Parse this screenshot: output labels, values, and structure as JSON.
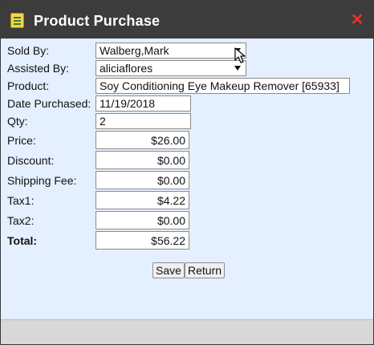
{
  "window": {
    "title": "Product Purchase",
    "icon": "notepad-icon",
    "close_icon": "close-icon"
  },
  "form": {
    "sold_by": {
      "label": "Sold By:",
      "value": "Walberg,Mark"
    },
    "assisted_by": {
      "label": "Assisted By:",
      "value": "aliciaflores"
    },
    "product": {
      "label": "Product:",
      "value": "Soy Conditioning Eye Makeup Remover [65933]"
    },
    "date_purchased": {
      "label": "Date Purchased:",
      "value": "11/19/2018"
    },
    "qty": {
      "label": "Qty:",
      "value": "2"
    },
    "price": {
      "label": "Price:",
      "value": "$26.00"
    },
    "discount": {
      "label": "Discount:",
      "value": "$0.00"
    },
    "shipping_fee": {
      "label": "Shipping Fee:",
      "value": "$0.00"
    },
    "tax1": {
      "label": "Tax1:",
      "value": "$4.22"
    },
    "tax2": {
      "label": "Tax2:",
      "value": "$0.00"
    },
    "total": {
      "label": "Total:",
      "value": "$56.22"
    }
  },
  "buttons": {
    "save": "Save",
    "return": "Return"
  },
  "colors": {
    "titlebar": "#3c3c3c",
    "body_bg": "#e4efff",
    "close": "#e8321f"
  }
}
